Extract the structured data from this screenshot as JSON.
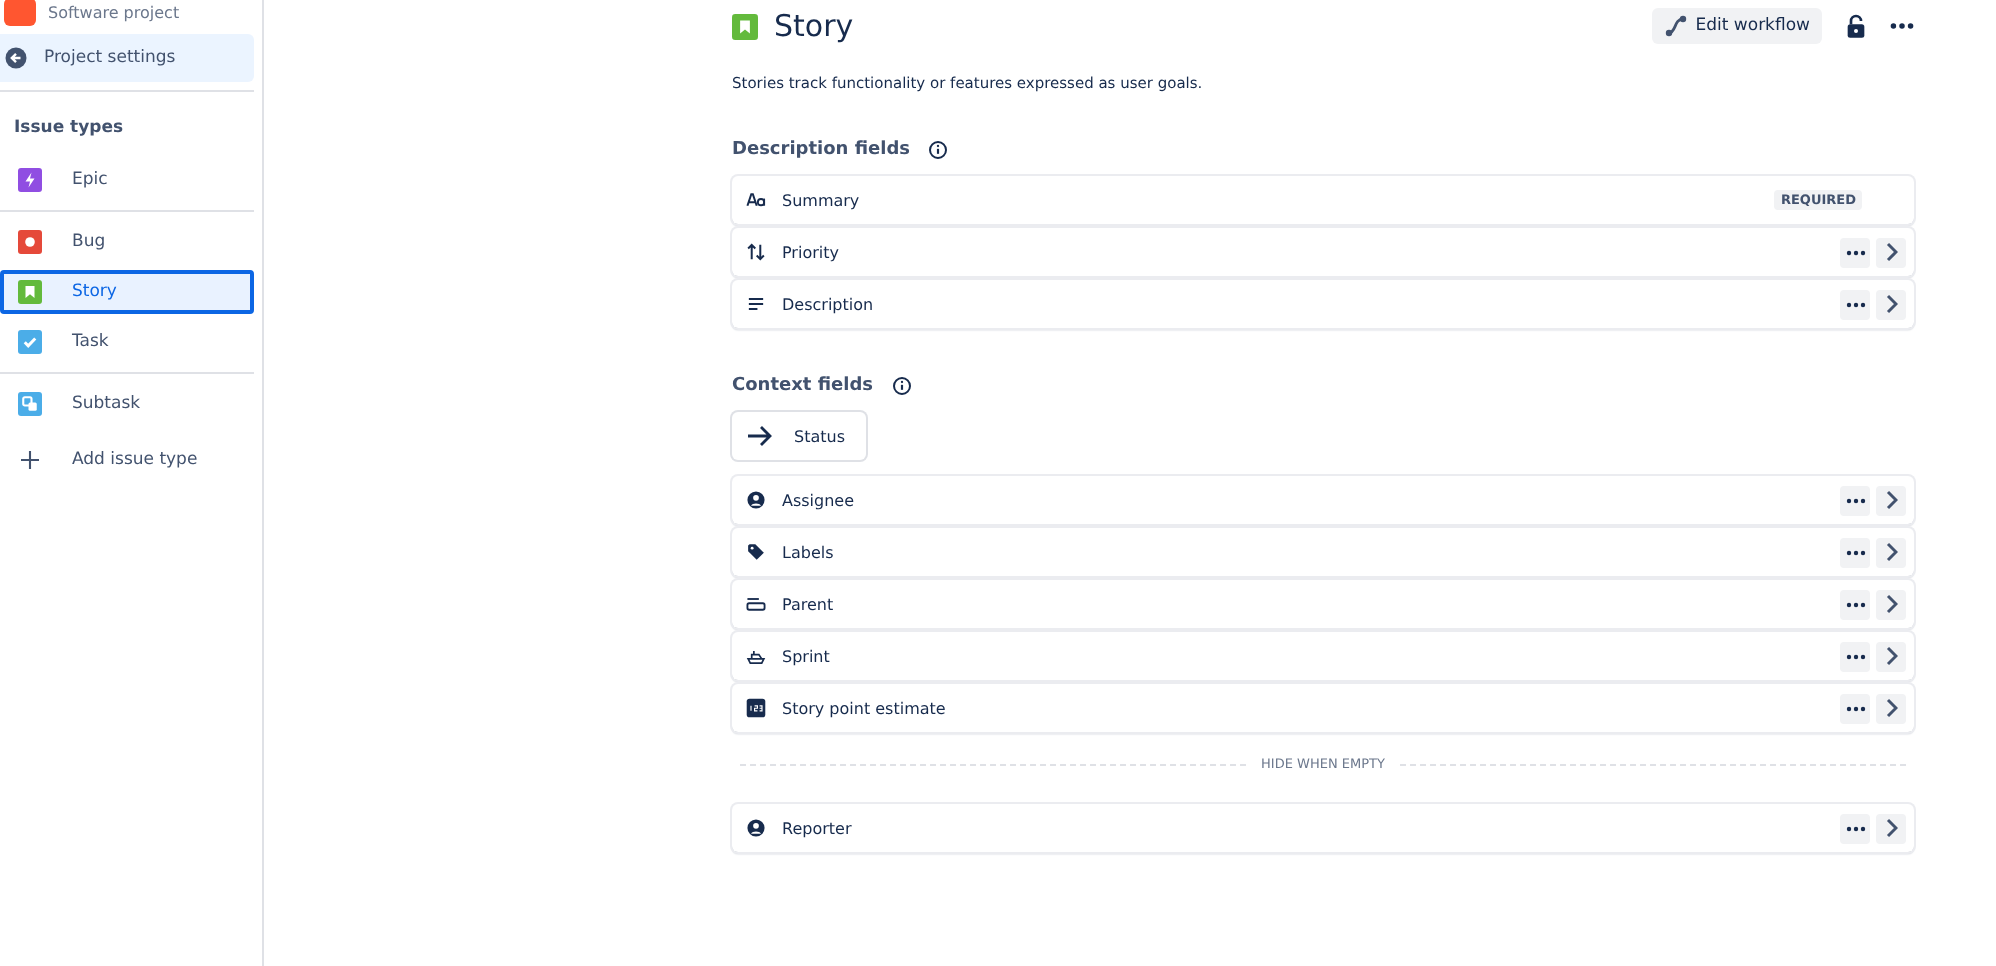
{
  "sidebar": {
    "project_type": "Software project",
    "back_link": "Project settings",
    "section_title": "Issue types",
    "issue_type_groups": [
      [
        {
          "label": "Epic",
          "kind": "epic",
          "color": "#904ee2",
          "selected": false
        }
      ],
      [
        {
          "label": "Bug",
          "kind": "bug",
          "color": "#e5493a",
          "selected": false
        },
        {
          "label": "Story",
          "kind": "story",
          "color": "#63ba3c",
          "selected": true
        },
        {
          "label": "Task",
          "kind": "task",
          "color": "#4bade8",
          "selected": false
        }
      ],
      [
        {
          "label": "Subtask",
          "kind": "subtask",
          "color": "#4bade8",
          "selected": false
        }
      ]
    ],
    "add_label": "Add issue type"
  },
  "header": {
    "title": "Story",
    "edit_workflow": "Edit workflow",
    "description": "Stories track functionality or features expressed as user goals."
  },
  "description_section": {
    "title": "Description fields",
    "fields": [
      {
        "label": "Summary",
        "kind": "text",
        "required": true,
        "badge": "REQUIRED"
      },
      {
        "label": "Priority",
        "kind": "priority",
        "required": false
      },
      {
        "label": "Description",
        "kind": "lines",
        "required": false
      }
    ]
  },
  "context_section": {
    "title": "Context fields",
    "status_chip": "Status",
    "fields": [
      {
        "label": "Assignee",
        "kind": "person",
        "required": false
      },
      {
        "label": "Labels",
        "kind": "tag",
        "required": false
      },
      {
        "label": "Parent",
        "kind": "parent",
        "required": false
      },
      {
        "label": "Sprint",
        "kind": "sprint",
        "required": false
      },
      {
        "label": "Story point estimate",
        "kind": "number",
        "required": false
      }
    ],
    "divider_label": "HIDE WHEN EMPTY",
    "hidden_fields": [
      {
        "label": "Reporter",
        "kind": "person",
        "required": false
      }
    ]
  }
}
